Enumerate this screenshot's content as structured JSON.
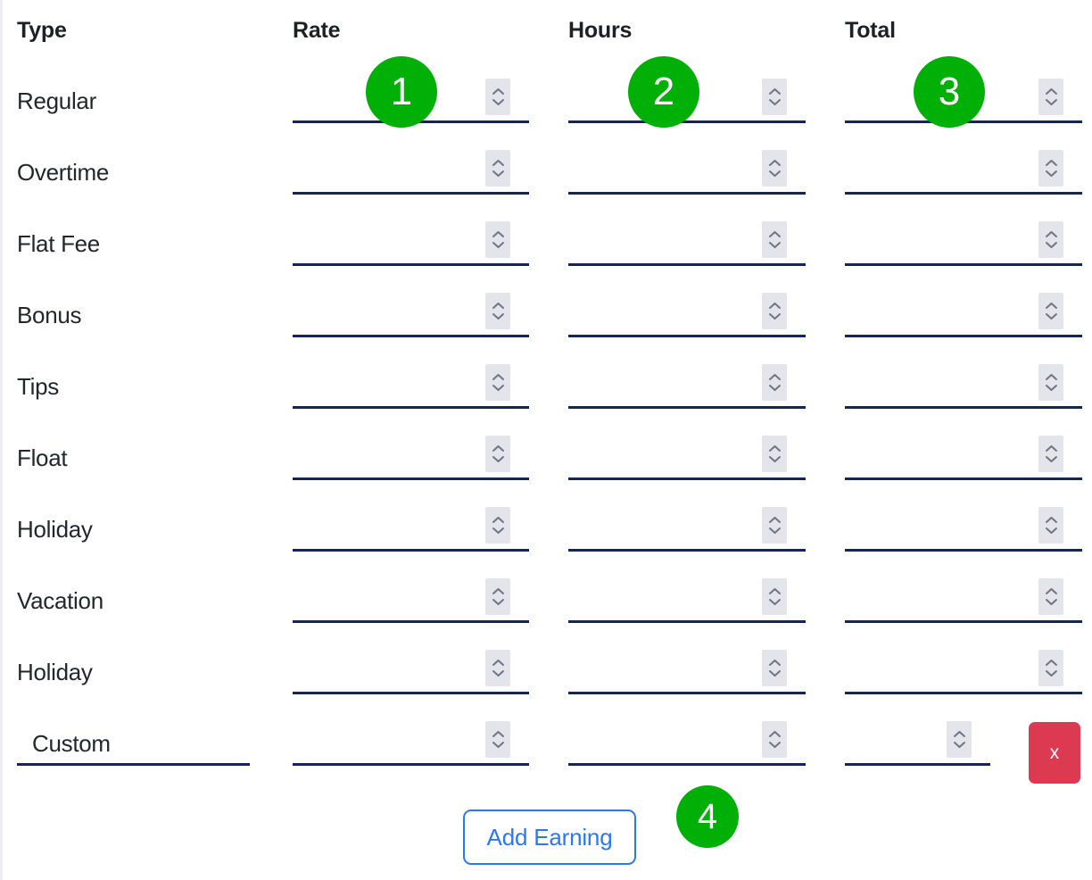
{
  "table": {
    "columns": [
      {
        "key": "type",
        "label": "Type"
      },
      {
        "key": "rate",
        "label": "Rate"
      },
      {
        "key": "hours",
        "label": "Hours"
      },
      {
        "key": "total",
        "label": "Total"
      }
    ],
    "rows": [
      {
        "type": "Regular",
        "rate": "",
        "hours": "",
        "total": ""
      },
      {
        "type": "Overtime",
        "rate": "",
        "hours": "",
        "total": ""
      },
      {
        "type": "Flat Fee",
        "rate": "",
        "hours": "",
        "total": ""
      },
      {
        "type": "Bonus",
        "rate": "",
        "hours": "",
        "total": ""
      },
      {
        "type": "Tips",
        "rate": "",
        "hours": "",
        "total": ""
      },
      {
        "type": "Float",
        "rate": "",
        "hours": "",
        "total": ""
      },
      {
        "type": "Holiday",
        "rate": "",
        "hours": "",
        "total": ""
      },
      {
        "type": "Vacation",
        "rate": "",
        "hours": "",
        "total": ""
      },
      {
        "type": "Holiday",
        "rate": "",
        "hours": "",
        "total": ""
      }
    ],
    "custom_row": {
      "type_placeholder": "Custom",
      "type_value": "",
      "rate": "",
      "hours": "",
      "total": "",
      "delete_label": "x"
    }
  },
  "actions": {
    "add_earning_label": "Add Earning"
  },
  "annotations": [
    {
      "id": "1",
      "target": "rate-column"
    },
    {
      "id": "2",
      "target": "hours-column"
    },
    {
      "id": "3",
      "target": "total-column"
    },
    {
      "id": "4",
      "target": "add-earning-button"
    }
  ],
  "icons": {
    "spinner": "spinner-stepper-icon",
    "chevron_up": "chevron-up-icon",
    "chevron_down": "chevron-down-icon",
    "delete": "close-x-icon"
  },
  "colors": {
    "underline": "#152461",
    "badge_green": "#00b006",
    "add_button_blue": "#2979f3",
    "delete_red": "#dc3a51",
    "spinner_bg": "#e4e5ea",
    "text": "#23262b"
  }
}
